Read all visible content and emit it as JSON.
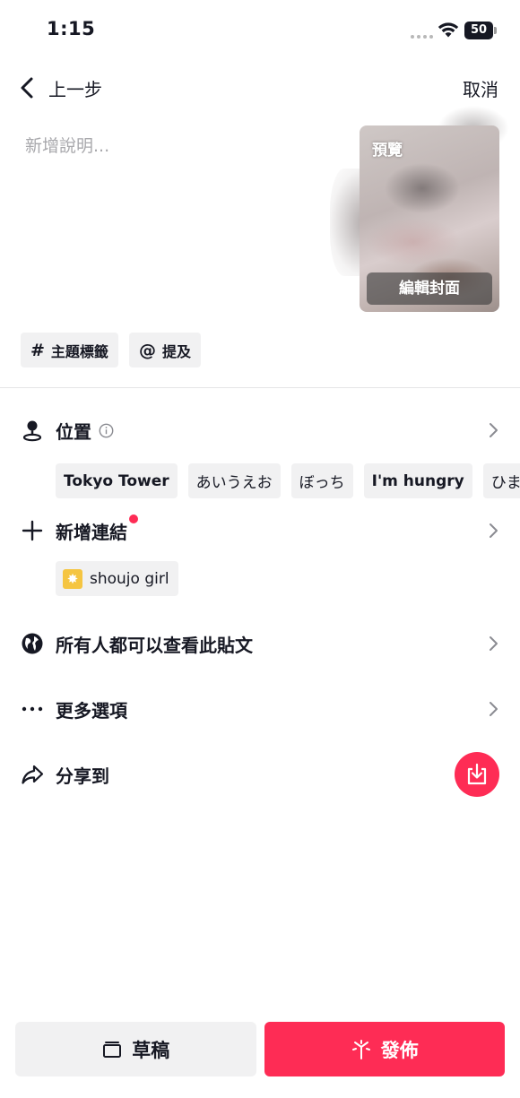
{
  "status_bar": {
    "time": "1:15",
    "battery": "50"
  },
  "header": {
    "back_label": "上一步",
    "cancel_label": "取消"
  },
  "caption": {
    "placeholder": "新增說明..."
  },
  "cover": {
    "preview_label": "預覽",
    "edit_label": "編輯封面"
  },
  "chips": {
    "hashtag_label": "主題標籤",
    "mention_label": "提及",
    "hashtag_icon": "#",
    "mention_icon": "@"
  },
  "location": {
    "label": "位置",
    "suggestions": [
      "Tokyo Tower",
      "あいうえお",
      "ぼっち",
      "I'm hungry",
      "ひまつ"
    ]
  },
  "add_link": {
    "label": "新增連結",
    "link_chip": "shoujo girl"
  },
  "privacy": {
    "label": "所有人都可以查看此貼文"
  },
  "more_options": {
    "label": "更多選項"
  },
  "share": {
    "label": "分享到"
  },
  "bottom": {
    "draft_label": "草稿",
    "post_label": "發佈"
  },
  "colors": {
    "accent": "#fe2c55",
    "chip_bg": "#f1f1f2",
    "text": "#161823"
  }
}
